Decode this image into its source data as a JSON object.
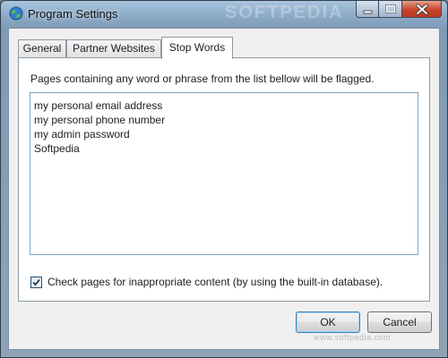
{
  "window": {
    "title": "Program Settings"
  },
  "tabs": [
    {
      "label": "General"
    },
    {
      "label": "Partner Websites"
    },
    {
      "label": "Stop Words"
    }
  ],
  "stop_words_tab": {
    "description": "Pages containing any word or phrase from the list bellow will be flagged.",
    "words": [
      "my personal email address",
      "my personal phone number",
      "my admin password",
      "Softpedia"
    ],
    "checkbox": {
      "checked": true,
      "label": "Check pages for inappropriate content (by using the built-in database)."
    }
  },
  "buttons": {
    "ok": "OK",
    "cancel": "Cancel"
  },
  "watermark": {
    "title_text": "SOFTPEDIA",
    "footer_text": "www.softpedia.com"
  },
  "icons": {
    "app": "globe-icon",
    "minimize": "minimize-icon",
    "maximize": "maximize-icon",
    "close": "close-icon",
    "check": "checkmark-icon"
  },
  "colors": {
    "accent": "#3c7fb1",
    "close_button": "#c7432a"
  }
}
